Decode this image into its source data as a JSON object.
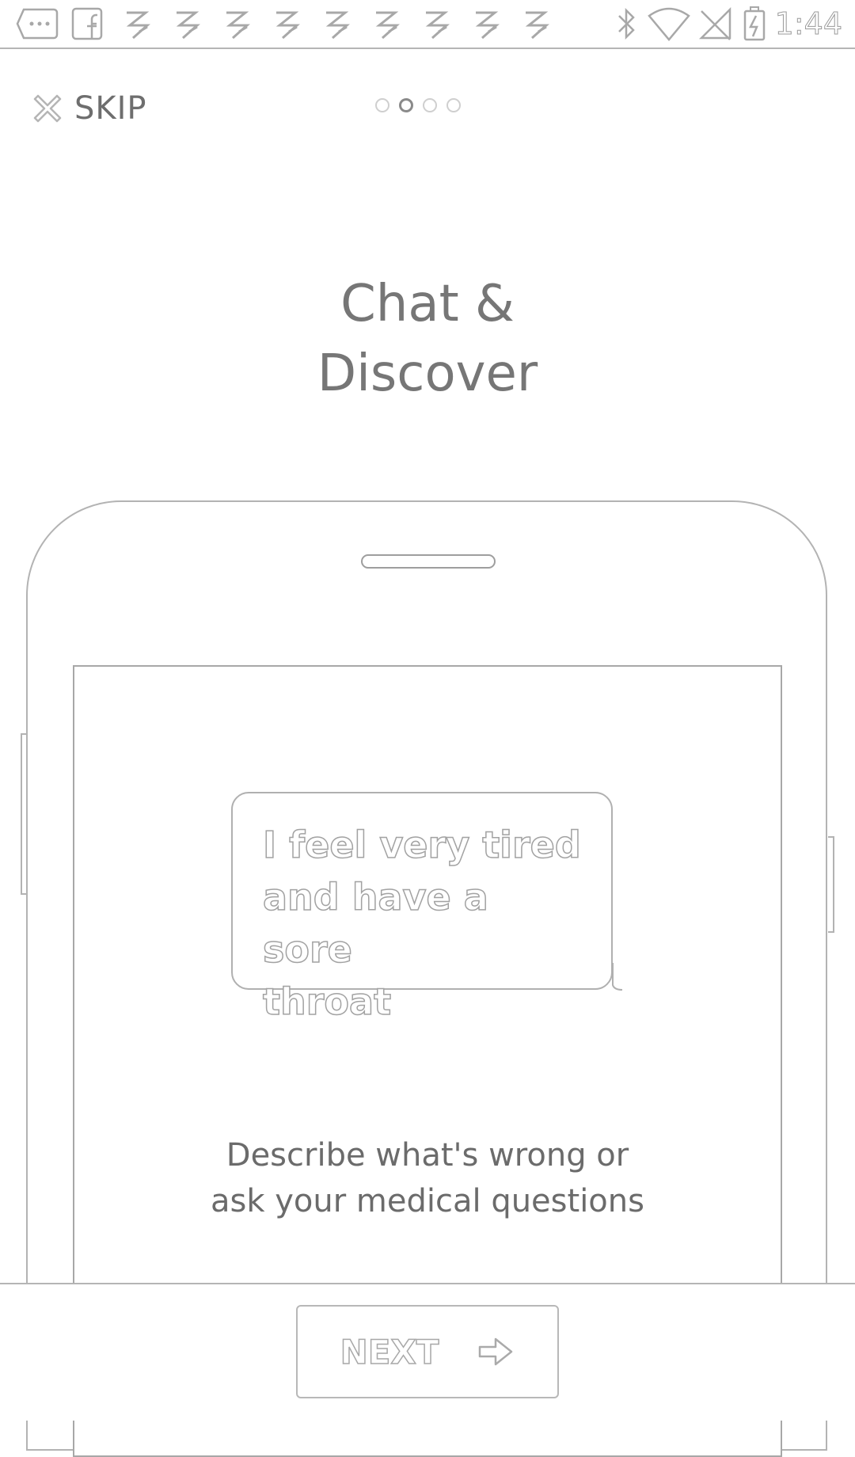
{
  "status_bar": {
    "time": "1:44",
    "left_icons": [
      "more-notification-icon",
      "facebook-icon",
      "app-notification-icon",
      "app-notification-icon",
      "app-notification-icon",
      "app-notification-icon",
      "app-notification-icon",
      "app-notification-icon",
      "app-notification-icon",
      "app-notification-icon",
      "app-notification-icon"
    ],
    "right_icons": [
      "bluetooth-icon",
      "wifi-icon",
      "no-signal-icon",
      "battery-charging-icon"
    ]
  },
  "header": {
    "skip_label": "SKIP",
    "page_indicator": {
      "total": 4,
      "current": 2
    }
  },
  "title": {
    "line1": "Chat &",
    "line2": "Discover"
  },
  "phone": {
    "chat_bubble": {
      "line1": "I feel very tired",
      "line2": "and have a sore",
      "line3": "throat"
    },
    "description": {
      "line1": "Describe what's wrong or",
      "line2": "ask your medical questions"
    }
  },
  "footer": {
    "next_label": "NEXT"
  },
  "colors": {
    "outline": "#b3b3b3",
    "text": "#6a6a6a",
    "background": "#ffffff"
  }
}
